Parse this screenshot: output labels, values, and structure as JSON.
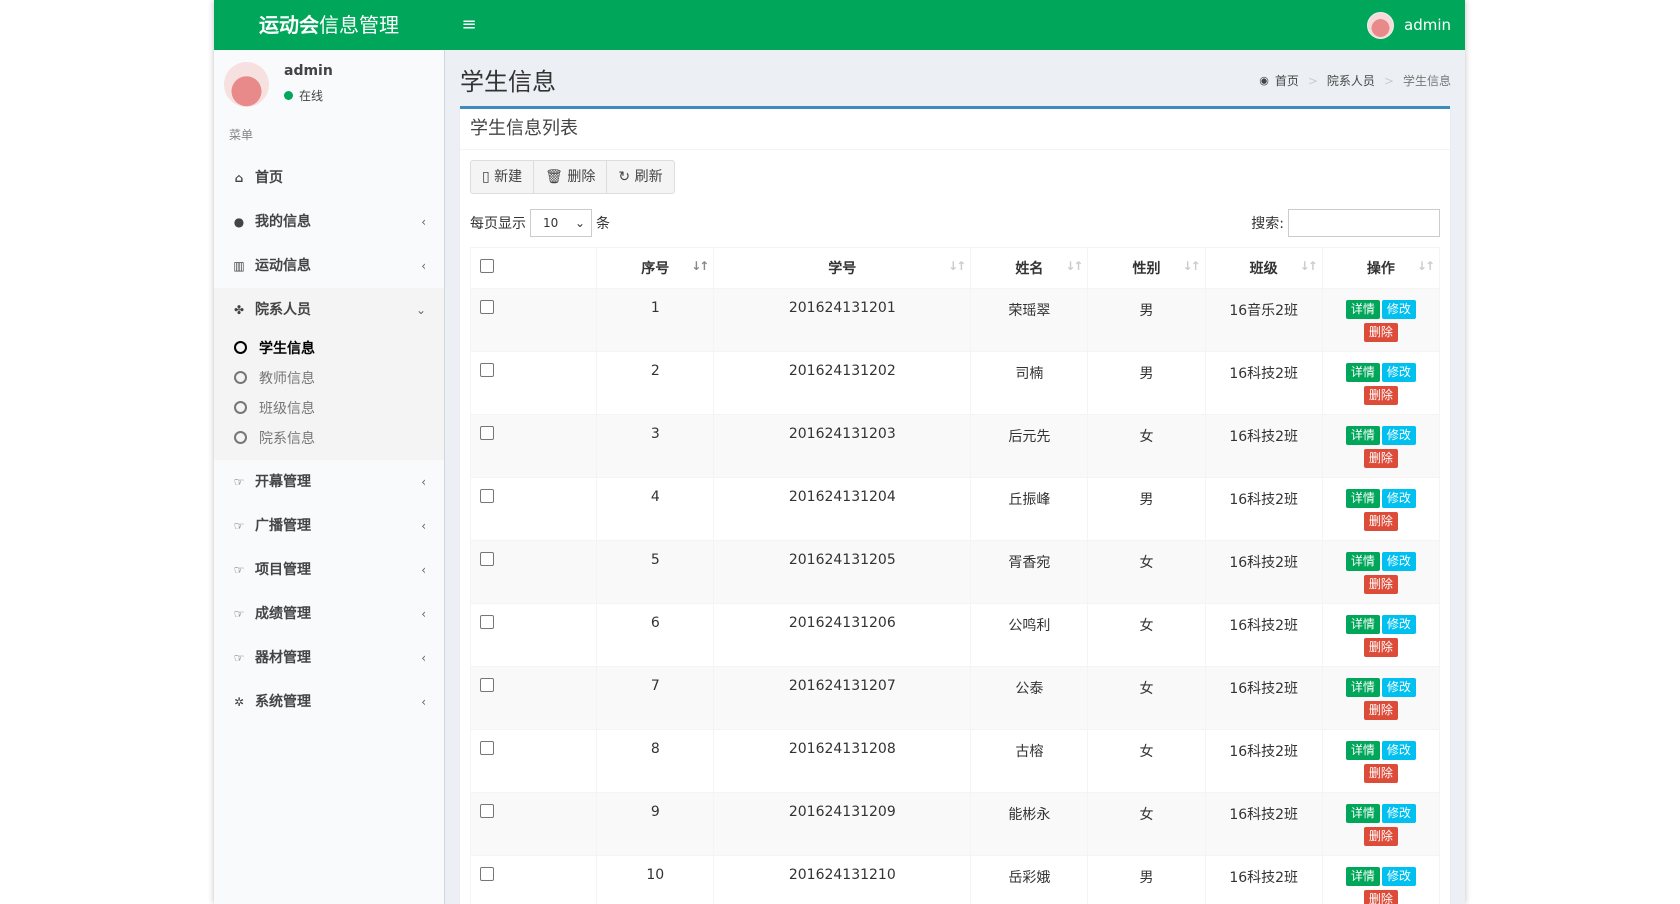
{
  "header": {
    "logo_bold": "运动会",
    "logo_rest": "信息管理",
    "toggle_icon": "hamburger-icon",
    "user": "admin"
  },
  "sidebar": {
    "user_name": "admin",
    "status": "在线",
    "menu_header": "菜单",
    "items": [
      {
        "label": "首页",
        "icon": "home-icon"
      },
      {
        "label": "我的信息",
        "icon": "user-icon"
      },
      {
        "label": "运动信息",
        "icon": "bar-chart-icon"
      },
      {
        "label": "院系人员",
        "icon": "paw-icon"
      },
      {
        "label": "开幕管理",
        "icon": "hand-point-icon"
      },
      {
        "label": "广播管理",
        "icon": "hand-point-icon"
      },
      {
        "label": "项目管理",
        "icon": "hand-point-icon"
      },
      {
        "label": "成绩管理",
        "icon": "hand-point-icon"
      },
      {
        "label": "器材管理",
        "icon": "hand-point-icon"
      },
      {
        "label": "系统管理",
        "icon": "gear-icon"
      }
    ],
    "subitems": [
      "学生信息",
      "教师信息",
      "班级信息",
      "院系信息"
    ]
  },
  "content": {
    "page_title": "学生信息",
    "breadcrumb": [
      "首页",
      "院系人员",
      "学生信息"
    ],
    "box_title": "学生信息列表",
    "buttons": {
      "new": "新建",
      "delete": "删除",
      "refresh": "刷新"
    },
    "length_prefix": "每页显示",
    "length_value": "10",
    "length_suffix": "条",
    "search_label": "搜索:",
    "columns": [
      "序号",
      "学号",
      "姓名",
      "性别",
      "班级",
      "操作"
    ],
    "op_labels": {
      "detail": "详情",
      "edit": "修改",
      "delete": "删除"
    },
    "rows": [
      {
        "no": "1",
        "id": "201624131201",
        "name": "荣瑶翠",
        "sex": "男",
        "cls": "16音乐2班"
      },
      {
        "no": "2",
        "id": "201624131202",
        "name": "司楠",
        "sex": "男",
        "cls": "16科技2班"
      },
      {
        "no": "3",
        "id": "201624131203",
        "name": "后元先",
        "sex": "女",
        "cls": "16科技2班"
      },
      {
        "no": "4",
        "id": "201624131204",
        "name": "丘振峰",
        "sex": "男",
        "cls": "16科技2班"
      },
      {
        "no": "5",
        "id": "201624131205",
        "name": "胥香宛",
        "sex": "女",
        "cls": "16科技2班"
      },
      {
        "no": "6",
        "id": "201624131206",
        "name": "公鸣利",
        "sex": "女",
        "cls": "16科技2班"
      },
      {
        "no": "7",
        "id": "201624131207",
        "name": "公泰",
        "sex": "女",
        "cls": "16科技2班"
      },
      {
        "no": "8",
        "id": "201624131208",
        "name": "古榕",
        "sex": "女",
        "cls": "16科技2班"
      },
      {
        "no": "9",
        "id": "201624131209",
        "name": "能彬永",
        "sex": "女",
        "cls": "16科技2班"
      },
      {
        "no": "10",
        "id": "201624131210",
        "name": "岳彩娥",
        "sex": "男",
        "cls": "16科技2班"
      }
    ]
  },
  "colors": {
    "brand": "#00a65a",
    "info": "#00c0ef",
    "danger": "#dd4b39",
    "primary": "#3c8dbc"
  }
}
